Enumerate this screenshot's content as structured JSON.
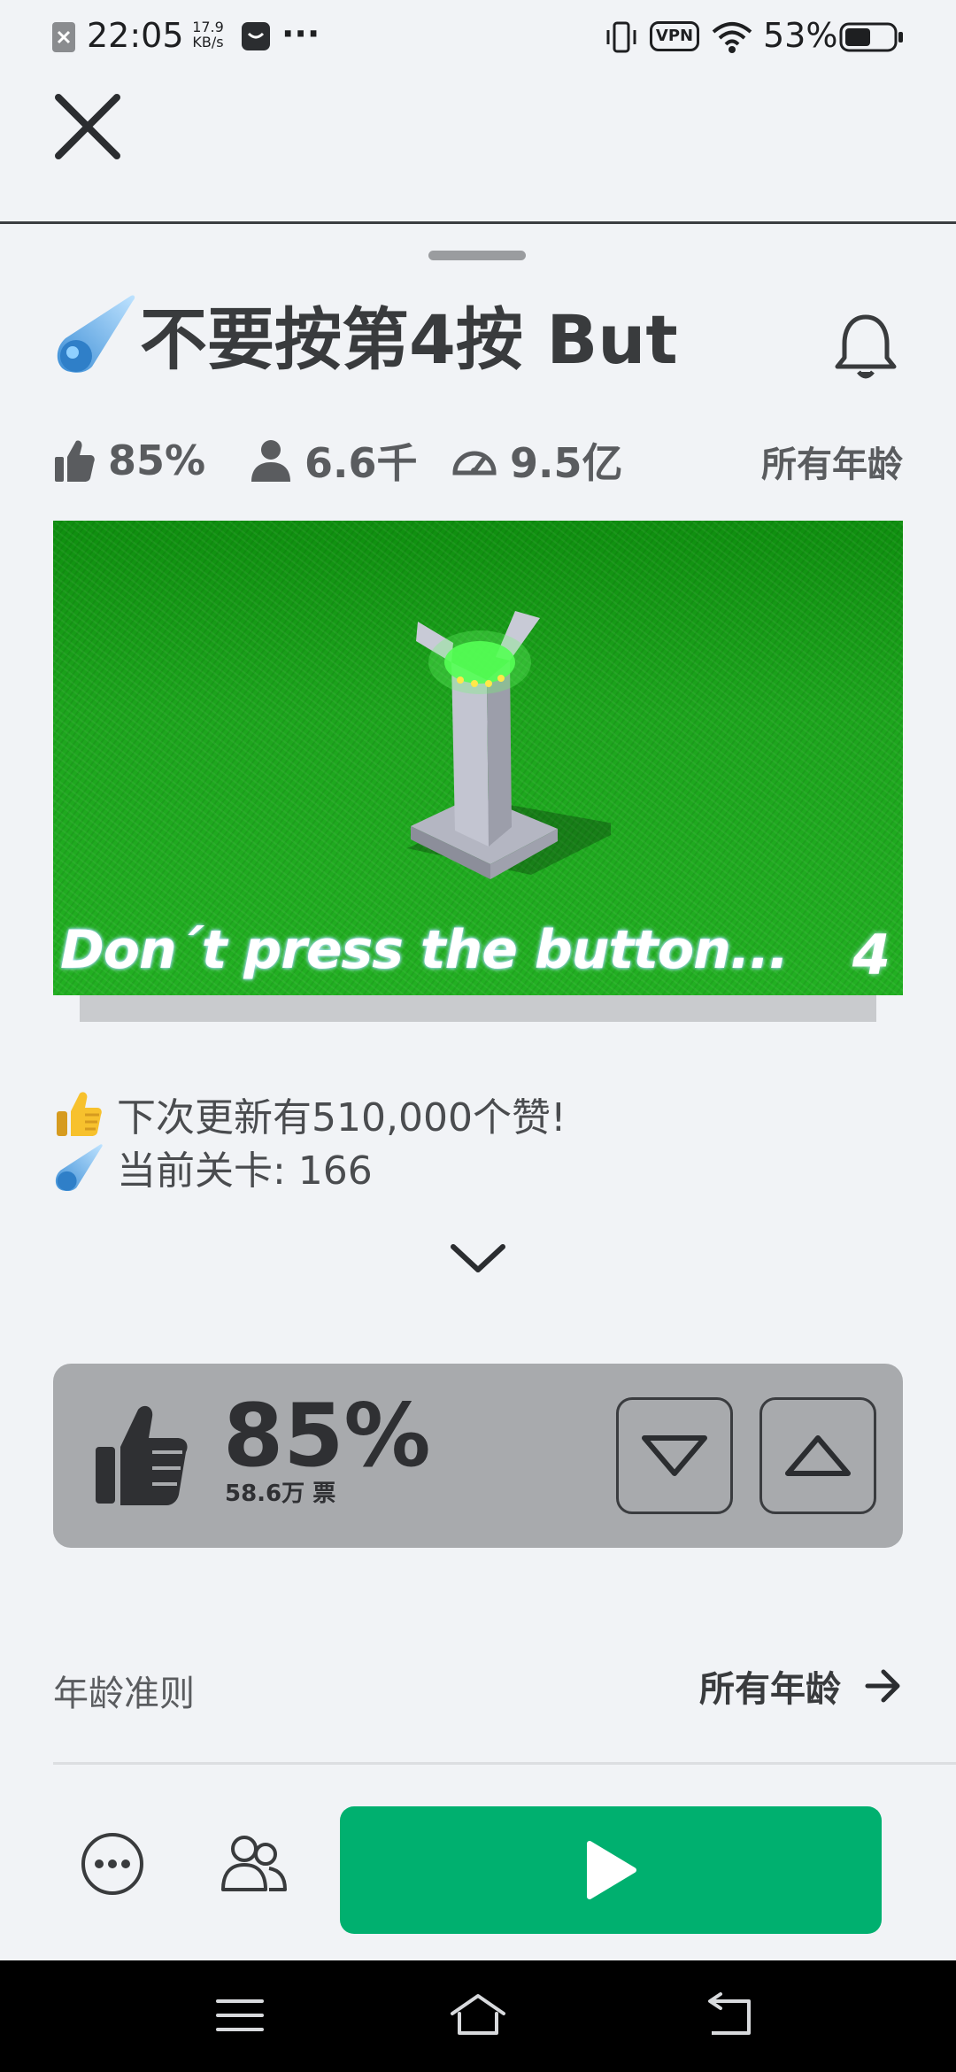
{
  "status_bar": {
    "time": "22:05",
    "net_speed_value": "17.9",
    "net_speed_unit": "KB/s",
    "more": "···",
    "vpn": "VPN",
    "battery": "53%",
    "battery_level": 0.53
  },
  "game": {
    "title": "不要按第4按 But",
    "stats": {
      "rating": "85%",
      "players": "6.6千",
      "visits": "9.5亿",
      "age": "所有年龄"
    },
    "thumbnail": {
      "caption": "Don´t press the button...",
      "badge": "4"
    },
    "description": [
      {
        "icon": "thumbs-up-emoji",
        "text": "下次更新有510,000个赞!"
      },
      {
        "icon": "comet-emoji",
        "text": "当前关卡: 166"
      }
    ]
  },
  "vote": {
    "percent": "85%",
    "count": "58.6万 票"
  },
  "age_guidelines": {
    "label": "年龄准则",
    "value": "所有年龄"
  },
  "colors": {
    "play_green": "#00b06f",
    "vote_panel": "#a8aaad",
    "background": "#f1f3f6"
  },
  "icons": [
    "close-icon",
    "comet-icon",
    "bell-icon",
    "thumb-up-icon",
    "person-icon",
    "speedometer-icon",
    "chevron-down-icon",
    "thumbs-down-icon",
    "arrow-right-icon",
    "more-icon",
    "friends-icon",
    "play-icon",
    "menu-icon",
    "home-icon",
    "back-icon"
  ]
}
